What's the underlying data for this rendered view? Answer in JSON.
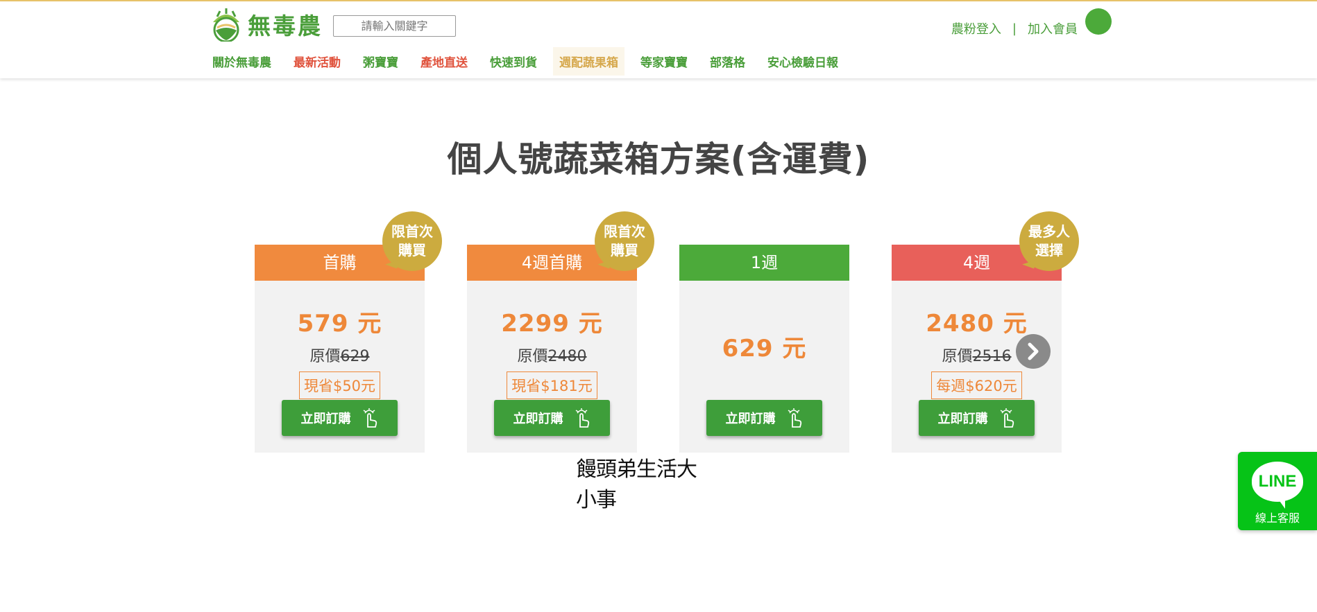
{
  "header": {
    "logo_text": "無毒農",
    "search_placeholder": "請輸入關鍵字",
    "login_label": "農粉登入",
    "separator": "|",
    "signup_label": "加入會員"
  },
  "nav": {
    "items": [
      {
        "label": "關於無毒農"
      },
      {
        "label": "最新活動"
      },
      {
        "label": "粥寶寶"
      },
      {
        "label": "產地直送"
      },
      {
        "label": "快速到貨"
      },
      {
        "label": "週配蔬果箱"
      },
      {
        "label": "等家寶寶"
      },
      {
        "label": "部落格"
      },
      {
        "label": "安心檢驗日報"
      }
    ]
  },
  "main": {
    "title": "個人號蔬菜箱方案(含運費)"
  },
  "plans": [
    {
      "name": "首購",
      "price": "579 元",
      "orig_prefix": "原價",
      "orig_price": "629",
      "save": "現省$50元",
      "buy_label": "立即訂購",
      "badge": [
        "限首次",
        "購買"
      ]
    },
    {
      "name": "4週首購",
      "price": "2299 元",
      "orig_prefix": "原價",
      "orig_price": "2480",
      "save": "現省$181元",
      "buy_label": "立即訂購",
      "badge": [
        "限首次",
        "購買"
      ]
    },
    {
      "name": "1週",
      "price": "629 元",
      "buy_label": "立即訂購"
    },
    {
      "name": "4週",
      "price": "2480 元",
      "orig_prefix": "原價",
      "orig_price": "2516",
      "save": "每週$620元",
      "buy_label": "立即訂購",
      "badge": [
        "最多人",
        "選擇"
      ]
    }
  ],
  "watermark": "饅頭弟生活大小事",
  "line_widget": {
    "logo": "LINE",
    "label": "線上客服"
  },
  "colors": {
    "brand_green": "#4a9e3a",
    "orange": "#f08a3e",
    "red": "#e8605a",
    "gold": "#ccab3f",
    "line_green": "#06c317"
  }
}
